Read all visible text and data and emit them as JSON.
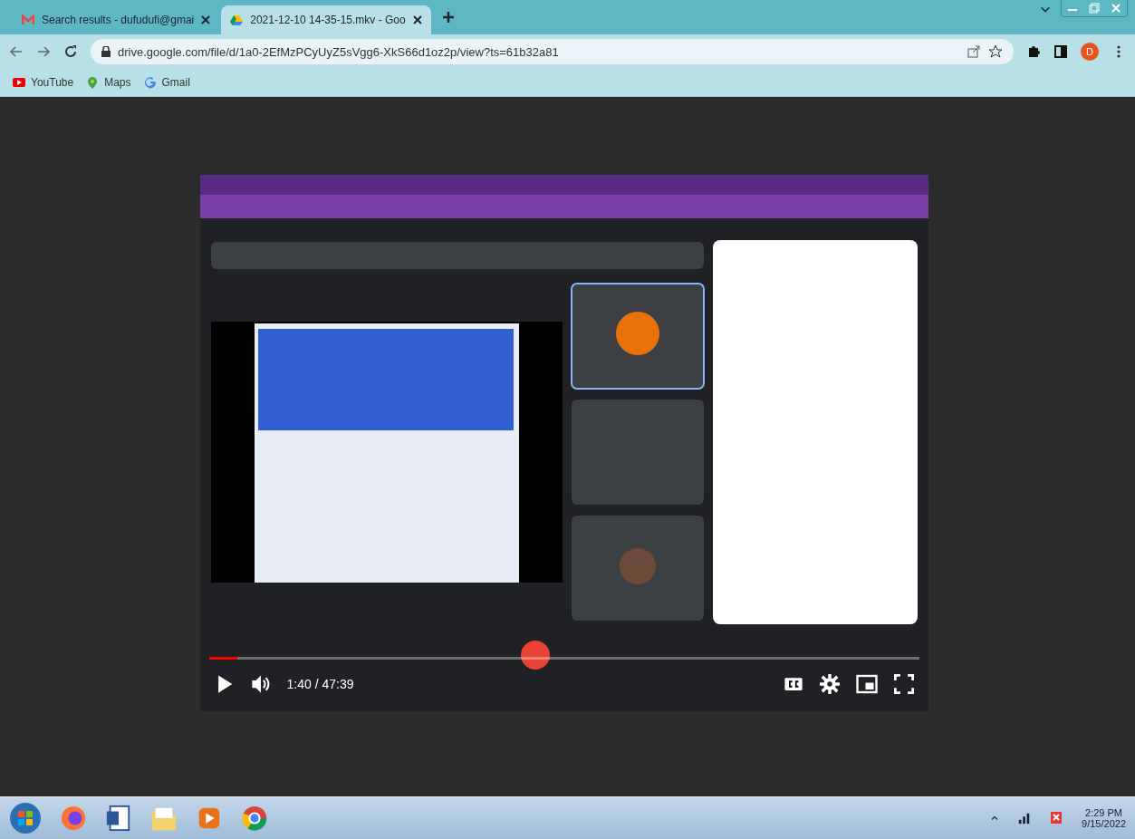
{
  "tabs": [
    {
      "title": "Search results - dufudufi@gmai",
      "selected": false
    },
    {
      "title": "2021-12-10 14-35-15.mkv - Goo",
      "selected": true
    }
  ],
  "address_bar": {
    "url": "drive.google.com/file/d/1a0-2EfMzPCyUyZ5sVgg6-XkS66d1oz2p/view?ts=61b32a81"
  },
  "profile": {
    "initial": "D"
  },
  "bookmarks": [
    "YouTube",
    "Maps",
    "Gmail"
  ],
  "player": {
    "time": "1:40 / 47:39",
    "progress": {
      "level": 0.04
    }
  },
  "taskbar": {
    "time": "2:29 PM",
    "date": "9/15/2022"
  }
}
